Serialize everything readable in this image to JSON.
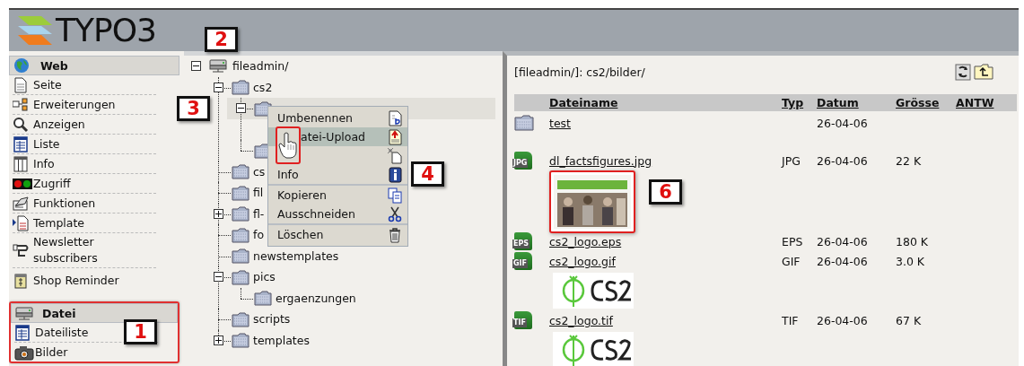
{
  "header": {
    "logo_text": "TYPO3"
  },
  "module_menu": [
    {
      "title": "Web",
      "outlined": false,
      "items": [
        {
          "label": "Seite"
        },
        {
          "label": "Erweiterungen"
        },
        {
          "label": "Anzeigen"
        },
        {
          "label": "Liste"
        },
        {
          "label": "Info"
        },
        {
          "label": "Zugriff"
        },
        {
          "label": "Funktionen"
        },
        {
          "label": "Template"
        },
        {
          "label": "Newsletter subscribers"
        },
        {
          "label": "Shop Reminder"
        }
      ]
    },
    {
      "title": "Datei",
      "outlined": true,
      "items": [
        {
          "label": "Dateiliste"
        },
        {
          "label": "Bilder"
        }
      ]
    }
  ],
  "tree": {
    "label": "fileadmin/",
    "expanded": true,
    "selected": false,
    "children": [
      {
        "label": "cs2",
        "expanded": true,
        "selected": false,
        "children": [
          {
            "expanded": true,
            "selected": true
          },
          {
            "selected": false
          }
        ]
      },
      {
        "label": "cs",
        "selected": false
      },
      {
        "label": "fil",
        "selected": false
      },
      {
        "label": "fl-",
        "expanded": false,
        "selected": false
      },
      {
        "label": "fo",
        "selected": false
      },
      {
        "label": "newstemplates",
        "selected": false
      },
      {
        "label": "pics",
        "expanded": true,
        "selected": false,
        "children": [
          {
            "label": "ergaenzungen",
            "selected": false
          }
        ]
      },
      {
        "label": "scripts",
        "selected": false
      },
      {
        "label": "templates",
        "expanded": false,
        "selected": false
      }
    ]
  },
  "context_menu": [
    {
      "kind": "item",
      "label": "Umbenennen",
      "highlighted": false,
      "cursor": false
    },
    {
      "kind": "item",
      "label": "atei-Upload",
      "highlighted": true,
      "cursor": true
    },
    {
      "kind": "item",
      "highlighted": false,
      "cursor": false
    },
    {
      "kind": "item",
      "label": "Info",
      "highlighted": false,
      "cursor": false
    },
    {
      "kind": "divider"
    },
    {
      "kind": "item",
      "label": "Kopieren",
      "highlighted": false,
      "cursor": false
    },
    {
      "kind": "item",
      "label": "Ausschneiden",
      "highlighted": false,
      "cursor": false
    },
    {
      "kind": "divider"
    },
    {
      "kind": "item",
      "label": "Löschen",
      "highlighted": false,
      "cursor": false
    }
  ],
  "file_list": {
    "path": "[fileadmin/]: cs2/bilder/",
    "columns": [
      "Dateiname",
      "Typ",
      "Datum",
      "Grösse",
      "ANTW"
    ],
    "rows": [
      {
        "kind": "folder",
        "name": "test",
        "date": "26-04-06"
      },
      {
        "kind": "file",
        "badge": "JPG",
        "name": "dl_factsfigures.jpg",
        "type": "JPG",
        "date": "26-04-06",
        "size": "22 K",
        "thumbnail": {
          "kind": "picture",
          "outlined": true
        }
      },
      {
        "kind": "file",
        "badge": "EPS",
        "name": "cs2_logo.eps",
        "type": "EPS",
        "date": "26-04-06",
        "size": "180 K"
      },
      {
        "kind": "file",
        "badge": "GIF",
        "name": "cs2_logo.gif",
        "type": "GIF",
        "date": "26-04-06",
        "size": "3.0 K",
        "thumbnail": {
          "kind": "picture",
          "outlined": false
        }
      },
      {
        "kind": "file",
        "badge": "TIF",
        "name": "cs2_logo.tif",
        "type": "TIF",
        "date": "26-04-06",
        "size": "67 K",
        "thumbnail": {
          "kind": "picture",
          "outlined": false
        }
      }
    ]
  },
  "annotations": [
    {
      "number": "2"
    },
    {
      "number": "3"
    },
    {
      "number": "4"
    },
    {
      "number": "1"
    },
    {
      "number": "6"
    }
  ]
}
